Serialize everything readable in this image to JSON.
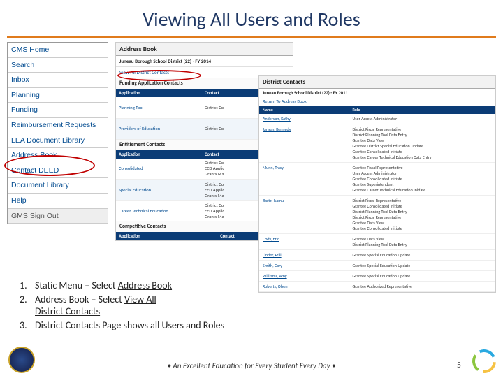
{
  "title": "Viewing All Users and Roles",
  "nav": {
    "items": [
      "CMS Home",
      "Search",
      "Inbox",
      "Planning",
      "Funding",
      "Reimbursement Requests",
      "LEA Document Library",
      "Address Book",
      "Contact DEED",
      "Document Library",
      "Help"
    ],
    "signout": "GMS Sign Out"
  },
  "ab": {
    "header": "Address Book",
    "district": "Juneau Borough School District (22) - FY 2014",
    "view_all": "View All District Contacts",
    "section1": "Funding Application Contacts",
    "th_app": "Application",
    "th_contact": "Contact",
    "r1a": "Planning Tool",
    "r1b": "District Co",
    "r2a": "Providers of Education",
    "r2b": "District Co",
    "section2": "Entitlement Contacts",
    "r3a": "Consolidated",
    "r3b": "District Co\nEED Applic\nGrants Ma",
    "r4a": "Special Education",
    "r4b": "District Co\nEED Applic\nGrants Ma",
    "r5a": "Career Technical Education",
    "r5b": "District Co\nEED Applic\nGrants Ma",
    "section3": "Competitive Contacts"
  },
  "dc": {
    "header": "District Contacts",
    "district": "Juneau Borough School District (22)  - FY 2011",
    "return": "Return To Address Book",
    "th_name": "Name",
    "th_role": "Role",
    "rows": [
      {
        "name": "Anderson, Kathy",
        "role": "User Access Administrator"
      },
      {
        "name": "Jansen, Kennedy",
        "role": "District Fiscal Representative\nDistrict Planning Tool Data Entry\nGrantee Data View\nGrantee District Special Education Update\nGrantee Consolidated Initiate\nGrantee Career Technical Education Data Entry"
      },
      {
        "name": "Munn, Tracy",
        "role": "Grantee Fiscal Representative\nUser Access Administrator\nGrantee Consolidated Initiate\nGrantee Superintendent\nGrantee Career Technical Education Initiate"
      },
      {
        "name": "Bartz, Isamu",
        "role": "District Fiscal Representative\nGrantee Consolidated Initiate\nDistrict Planning Tool Data Entry\nDistrict Fiscal Representative\nGrantee Data View\nGrantee Consolidated Initiate"
      },
      {
        "name": "Cody, Eric",
        "role": "Grantee Data View\nDistrict Planning Tool Data Entry"
      },
      {
        "name": "Linder, Friil",
        "role": "Grantee Special Education Update"
      },
      {
        "name": "Smith, Cory",
        "role": "Grantee Special Education Update"
      },
      {
        "name": "Williams, Amy",
        "role": "Grantee Special Education Update"
      },
      {
        "name": "Roberts, Olsen",
        "role": "Grantee Authorized Representative"
      }
    ]
  },
  "instr": {
    "n1": "1.",
    "t1a": "Static Menu – Select ",
    "t1b": "Address Book",
    "n2": "2.",
    "t2a": "Address Book – Select ",
    "t2b": "View All",
    "t2c": "District Contacts",
    "n3": "3.",
    "t3": "District Contacts Page shows all Users and Roles"
  },
  "footer": "• An Excellent Education for Every Student Every Day •",
  "pagenum": "5"
}
